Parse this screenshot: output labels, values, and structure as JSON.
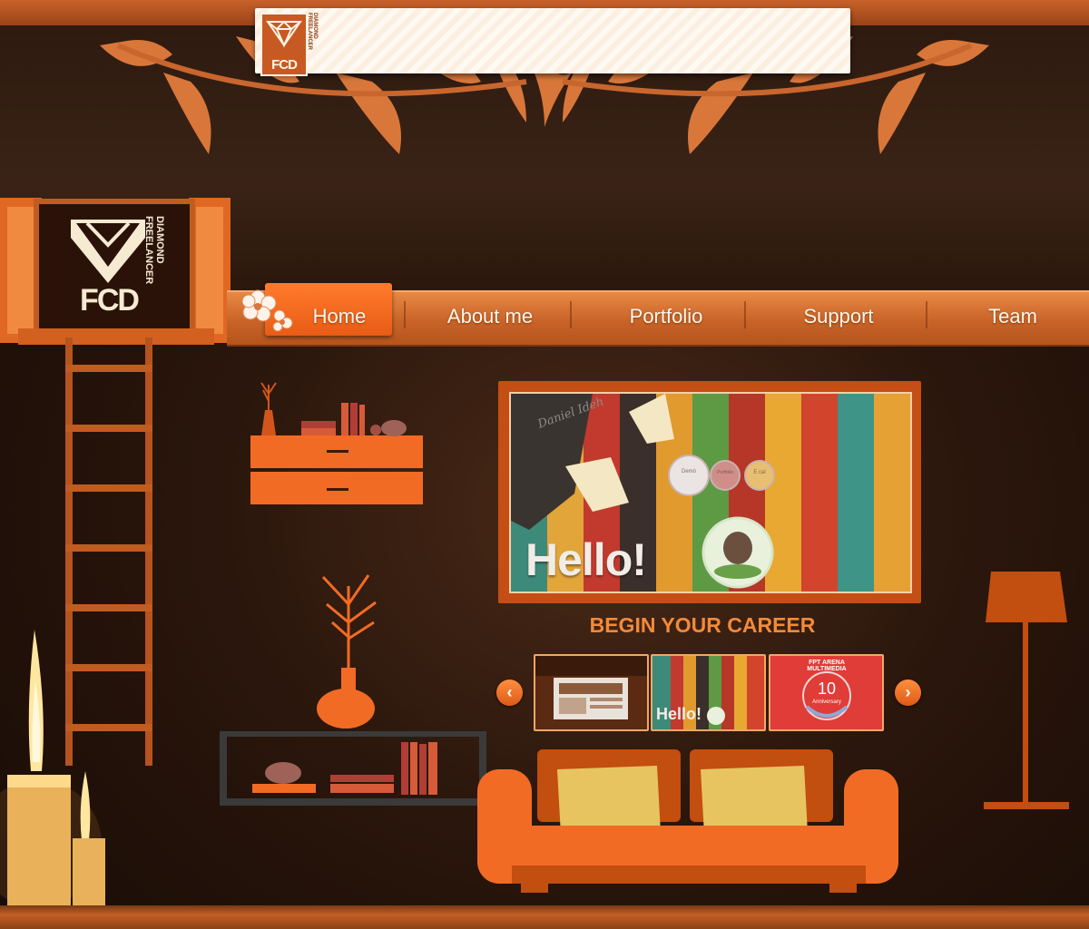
{
  "brand": {
    "logo_text": "FCD",
    "tagline": "DIAMOND FREELANCER"
  },
  "nav": {
    "items": [
      {
        "label": "Home",
        "active": true
      },
      {
        "label": "About me",
        "active": false
      },
      {
        "label": "Portfolio",
        "active": false
      },
      {
        "label": "Support",
        "active": false
      },
      {
        "label": "Team",
        "active": false
      }
    ]
  },
  "featured": {
    "slide_heading": "Hello!",
    "signature": "Daniel Ideh",
    "bubbles": [
      "Demò",
      "Portfolio",
      "E cal"
    ]
  },
  "career": {
    "heading": "BEGIN YOUR CAREER",
    "thumbnails": [
      {
        "label": ""
      },
      {
        "label": "Hello!"
      },
      {
        "label": "FPT ARENA MULTIMEDIA",
        "badge": "10",
        "badge_sub": "Anniversary"
      }
    ]
  },
  "colors": {
    "accent": "#e8641c",
    "nav_bar": "#c96428",
    "heading": "#f28a3a",
    "background": "#2a160c"
  },
  "icons": [
    "diamond-logo-icon",
    "flower-icon",
    "arrow-left-icon",
    "arrow-right-icon"
  ]
}
